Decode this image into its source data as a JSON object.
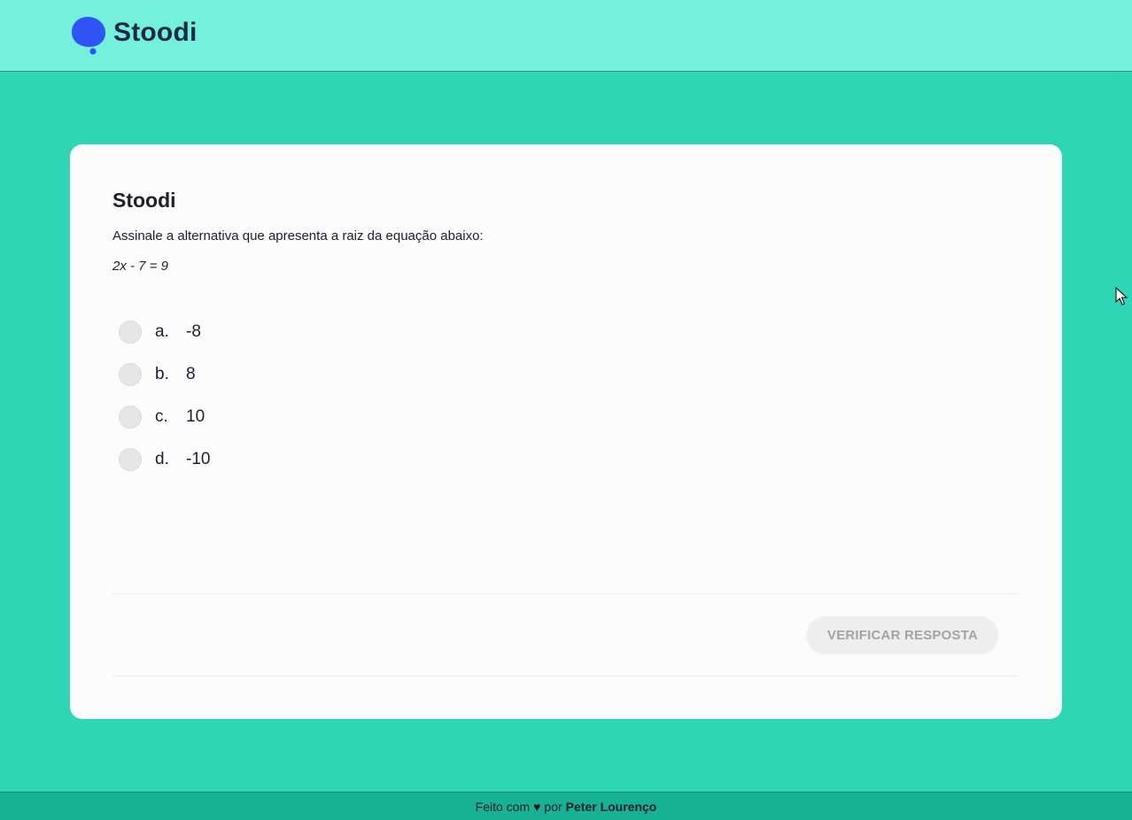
{
  "header": {
    "logo_text": "Stoodi",
    "logo_icon": "speech-bubble-icon",
    "logo_color": "#2f56f5"
  },
  "card": {
    "title": "Stoodi",
    "question": "Assinale a alternativa que apresenta a raiz da equação abaixo:",
    "equation": "2x - 7 = 9",
    "options": [
      {
        "letter": "a.",
        "value": "-8"
      },
      {
        "letter": "b.",
        "value": "8"
      },
      {
        "letter": "c.",
        "value": "10"
      },
      {
        "letter": "d.",
        "value": "-10"
      }
    ],
    "verify_button": "VERIFICAR RESPOSTA"
  },
  "footer": {
    "made_with": "Feito com",
    "heart_icon": "♥",
    "by": "por",
    "author": "Peter Lourenço"
  },
  "colors": {
    "page_background": "#2ed6b6",
    "header_background": "#74f0dc",
    "footer_background": "#17b194",
    "card_background": "#fcfcfc",
    "button_disabled": "#eeeeee"
  }
}
